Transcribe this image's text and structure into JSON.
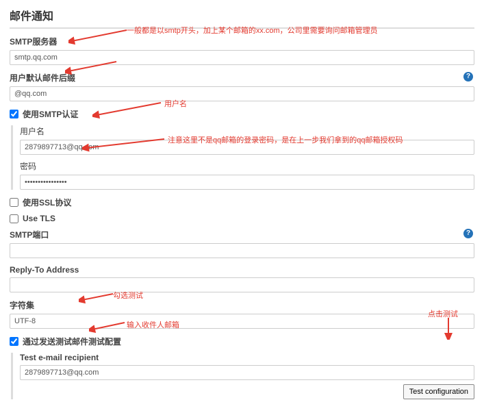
{
  "title": "邮件通知",
  "smtp_server": {
    "label": "SMTP服务器",
    "value": "smtp.qq.com"
  },
  "default_suffix": {
    "label": "用户默认邮件后缀",
    "value": "@qq.com"
  },
  "smtp_auth": {
    "label": "使用SMTP认证",
    "checked": true,
    "username_label": "用户名",
    "username_value": "2879897713@qq.com",
    "password_label": "密码",
    "password_value": "••••••••••••••••"
  },
  "use_ssl": {
    "label": "使用SSL协议",
    "checked": false
  },
  "use_tls": {
    "label": "Use TLS",
    "checked": false
  },
  "smtp_port": {
    "label": "SMTP端口",
    "value": ""
  },
  "reply_to": {
    "label": "Reply-To Address",
    "value": ""
  },
  "charset": {
    "label": "字符集",
    "value": "UTF-8"
  },
  "test_config": {
    "label": "通过发送测试邮件测试配置",
    "checked": true,
    "recipient_label": "Test e-mail recipient",
    "recipient_value": "2879897713@qq.com",
    "button": "Test configuration"
  },
  "annotations": {
    "a1": "一般都是以smtp开头，加上某个邮箱的xx.com，公司里需要询问邮箱管理员",
    "a2": "用户名",
    "a3": "注意这里不是qq邮箱的登录密码，是在上一步我们拿到的qq邮箱授权码",
    "a4": "勾选测试",
    "a5": "输入收件人邮箱",
    "a6": "点击测试"
  }
}
